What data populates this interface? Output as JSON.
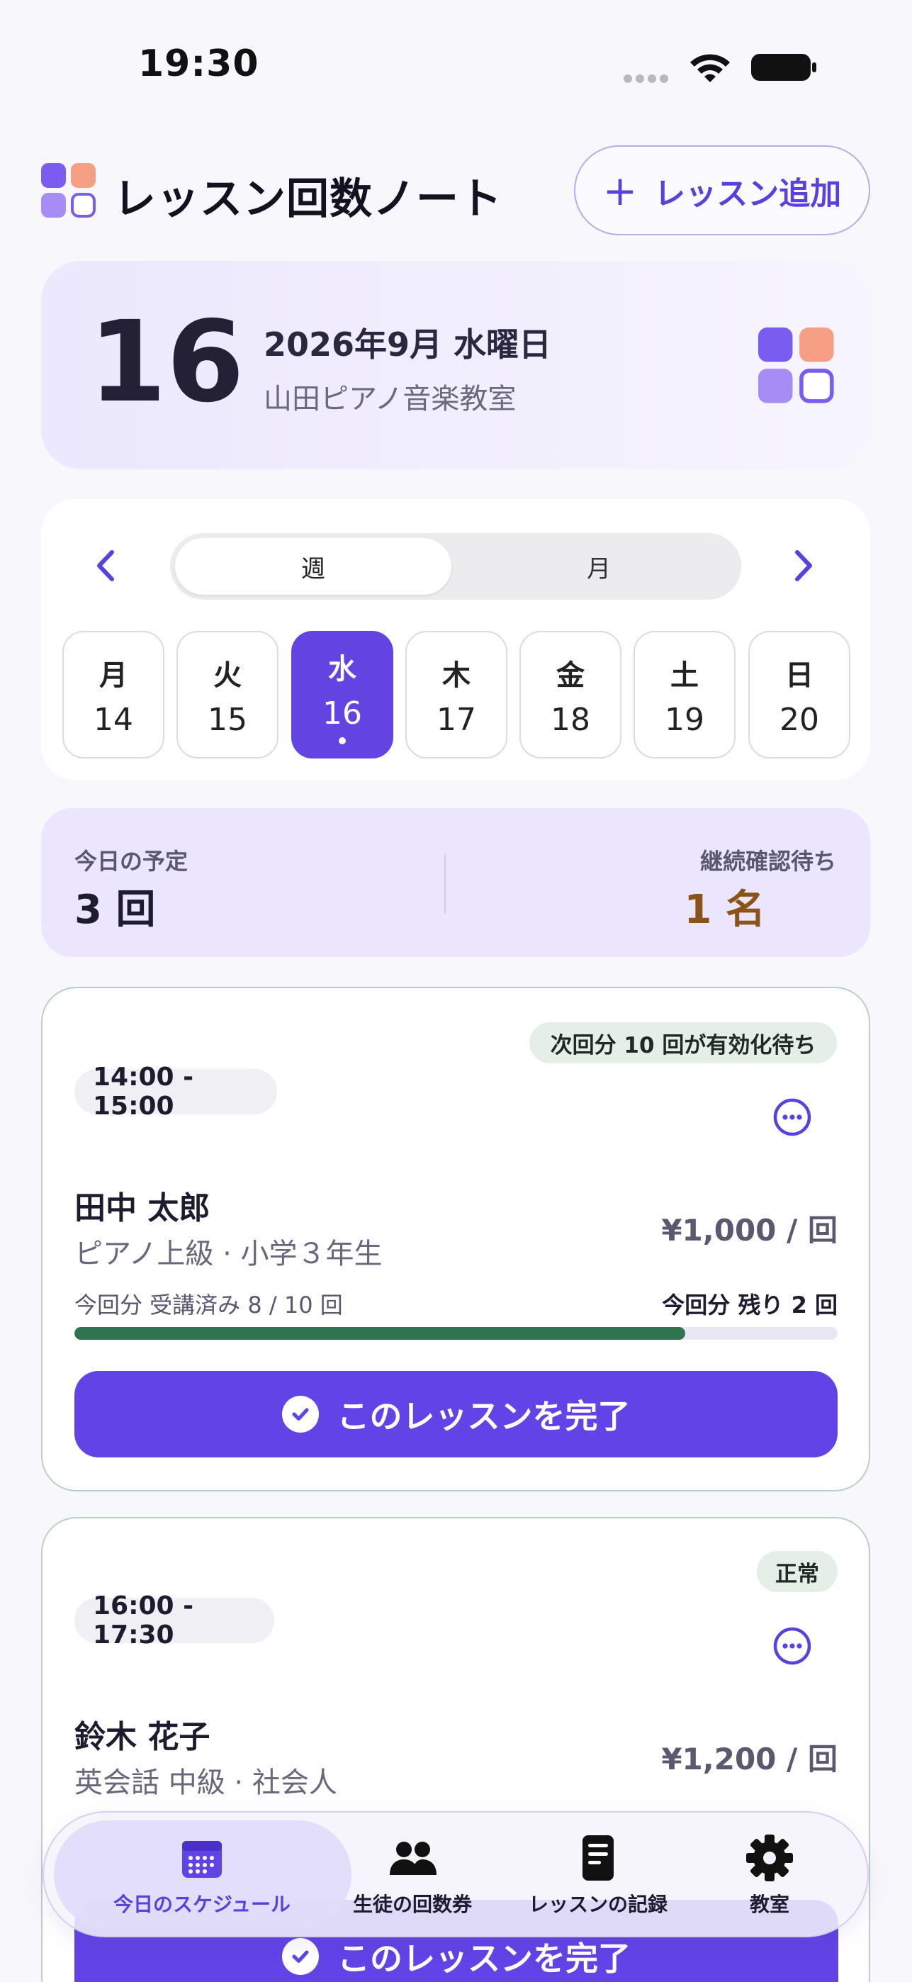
{
  "status_bar": {
    "time": "19:30"
  },
  "header": {
    "title": "レッスン回数ノート",
    "add_button_label": "レッスン追加",
    "add_button_icon": "plus-icon"
  },
  "date_card": {
    "day": "16",
    "full_date": "2026年9月 水曜日",
    "school_name": "山田ピアノ音楽教室"
  },
  "calendar": {
    "segments": {
      "week": "週",
      "month": "月"
    },
    "selected_segment": "週",
    "days": [
      {
        "weekday": "月",
        "date": "14"
      },
      {
        "weekday": "火",
        "date": "15"
      },
      {
        "weekday": "水",
        "date": "16",
        "selected": true,
        "has_events": true
      },
      {
        "weekday": "木",
        "date": "17"
      },
      {
        "weekday": "金",
        "date": "18"
      },
      {
        "weekday": "土",
        "date": "19"
      },
      {
        "weekday": "日",
        "date": "20"
      }
    ]
  },
  "summary": {
    "today_label": "今日の予定",
    "today_value": "3 回",
    "pending_label": "継続確認待ち",
    "pending_value": "1 名"
  },
  "lessons": [
    {
      "badge": "次回分 10 回が有効化待ち",
      "time": "14:00 - 15:00",
      "name": "田中 太郎",
      "subtitle": "ピアノ上級 · 小学３年生",
      "price": "¥1,000 / 回",
      "progress_label": "今回分 受講済み 8 / 10 回",
      "remaining_label": "今回分 残り 2 回",
      "progress": 0.8,
      "complete_label": "このレッスンを完了"
    },
    {
      "badge": "正常",
      "time": "16:00 - 17:30",
      "name": "鈴木 花子",
      "subtitle": "英会話 中級 · 社会人",
      "price": "¥1,200 / 回",
      "complete_label": "このレッスンを完了"
    }
  ],
  "tabbar": {
    "items": [
      {
        "label": "今日のスケジュール",
        "icon": "calendar-icon",
        "active": true
      },
      {
        "label": "生徒の回数券",
        "icon": "people-icon"
      },
      {
        "label": "レッスンの記録",
        "icon": "document-icon"
      },
      {
        "label": "教室",
        "icon": "gear-icon"
      }
    ]
  },
  "colors": {
    "accent": "#6143e6",
    "progress": "#2f7350",
    "pending": "#8a5319",
    "background": "#f8f7fc"
  }
}
